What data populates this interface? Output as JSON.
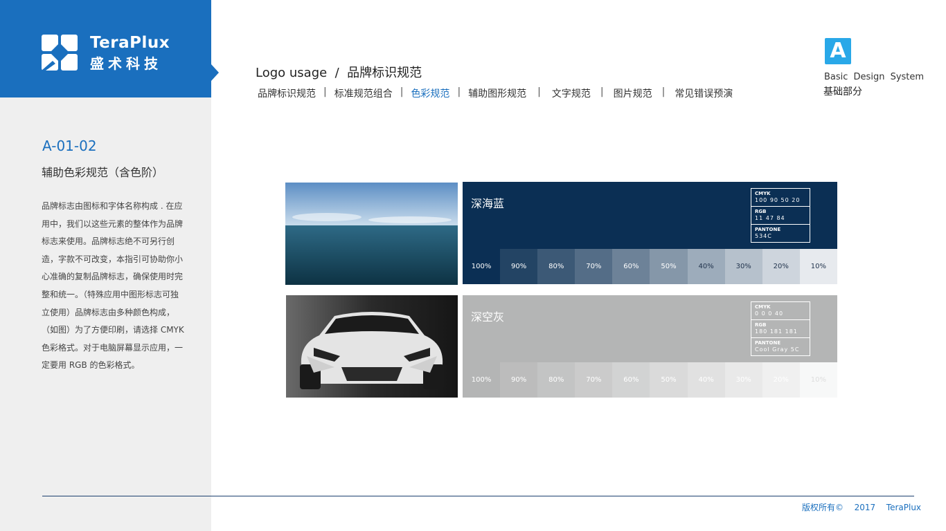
{
  "brand": {
    "name_en": "TeraPlux",
    "name_cn": "盛术科技",
    "color": "#1a6fbe"
  },
  "sidebar": {
    "code": "A-01-02",
    "subtitle": "辅助色彩规范（含色阶）",
    "description": "品牌标志由图标和字体名称构成 . 在应用中，我们以这些元素的整体作为品牌标志来使用。品牌标志绝不可另行创造，字款不可改变，本指引可协助你小心准确的复制品牌标志，确保使用时完整和统一。（特殊应用中图形标志可独立使用）品牌标志由多种颜色构成，（如图）为了方便印刷，请选择 CMYK 色彩格式。对于电脑屏幕显示应用，一定要用 RGB 的色彩格式。"
  },
  "header": {
    "title": "Logo usage  /  品牌标识规范",
    "nav": [
      {
        "label": "品牌标识规范",
        "active": false
      },
      {
        "label": "标准规范组合",
        "active": false
      },
      {
        "label": "色彩规范",
        "active": true
      },
      {
        "label": "辅助图形规范",
        "active": false
      },
      {
        "label": "文字规范",
        "active": false
      },
      {
        "label": "图片规范",
        "active": false
      },
      {
        "label": "常见错误预演",
        "active": false
      }
    ]
  },
  "system": {
    "badge": "A",
    "label_en": "Basic Design System",
    "label_cn": "基础部分"
  },
  "colors": [
    {
      "name": "深海蓝",
      "hex": "#0b2f54",
      "cmyk_label": "CMYK",
      "cmyk": "100 90 50 20",
      "rgb_label": "RGB",
      "rgb": "11 47 84",
      "pantone_label": "PANTONE",
      "pantone": "534C",
      "tints": [
        {
          "label": "100%",
          "bg": "#0b2f54",
          "fg": "#ffffff"
        },
        {
          "label": "90%",
          "bg": "#234464",
          "fg": "#ffffff"
        },
        {
          "label": "80%",
          "bg": "#3c5976",
          "fg": "#ffffff"
        },
        {
          "label": "70%",
          "bg": "#546d87",
          "fg": "#ffffff"
        },
        {
          "label": "60%",
          "bg": "#6d8298",
          "fg": "#ffffff"
        },
        {
          "label": "50%",
          "bg": "#8597a9",
          "fg": "#ffffff"
        },
        {
          "label": "40%",
          "bg": "#9dacbb",
          "fg": "#22344d"
        },
        {
          "label": "30%",
          "bg": "#b6c1cc",
          "fg": "#22344d"
        },
        {
          "label": "20%",
          "bg": "#ced5dd",
          "fg": "#22344d"
        },
        {
          "label": "10%",
          "bg": "#e7eaee",
          "fg": "#22344d"
        }
      ]
    },
    {
      "name": "深空灰",
      "hex": "#b4b5b5",
      "cmyk_label": "CMYK",
      "cmyk": "0 0 0 40",
      "rgb_label": "RGB",
      "rgb": "180 181 181",
      "pantone_label": "PANTONE",
      "pantone": "Cool Gray 5C",
      "tints": [
        {
          "label": "100%",
          "bg": "#b4b5b5",
          "fg": "#ffffff"
        },
        {
          "label": "90%",
          "bg": "#bcbcbc",
          "fg": "#ffffff"
        },
        {
          "label": "80%",
          "bg": "#c3c4c4",
          "fg": "#ffffff"
        },
        {
          "label": "70%",
          "bg": "#cbcbcb",
          "fg": "#ffffff"
        },
        {
          "label": "60%",
          "bg": "#d2d3d3",
          "fg": "#ffffff"
        },
        {
          "label": "50%",
          "bg": "#dadada",
          "fg": "#ffffff"
        },
        {
          "label": "40%",
          "bg": "#e1e1e1",
          "fg": "#ffffff"
        },
        {
          "label": "30%",
          "bg": "#e9e9e9",
          "fg": "#ffffff"
        },
        {
          "label": "20%",
          "bg": "#f0f0f0",
          "fg": "#ffffff"
        },
        {
          "label": "10%",
          "bg": "#f7f8f8",
          "fg": "#dddddd"
        }
      ]
    }
  ],
  "footer": {
    "copyright": "版权所有©  2017  TeraPlux"
  }
}
